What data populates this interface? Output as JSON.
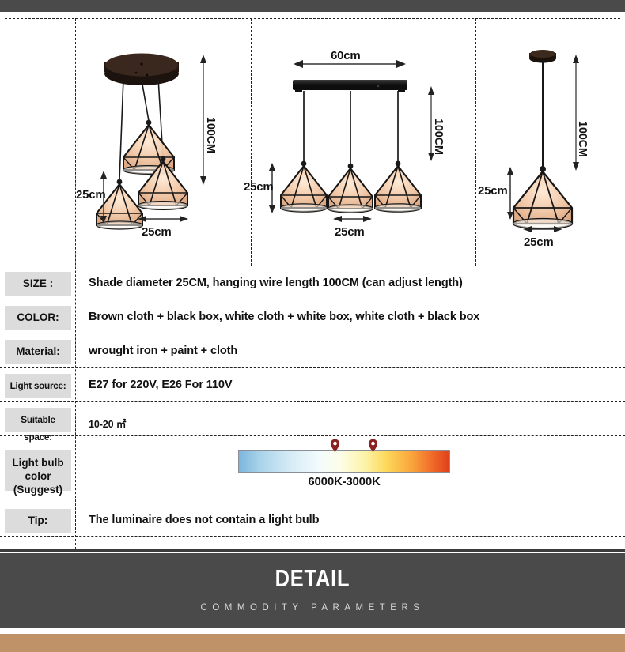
{
  "diagrams": {
    "panel_1": {
      "name": "three-light-round-canopy",
      "dim_height": "100CM",
      "dim_shade_height": "25cm",
      "dim_shade_width": "25cm"
    },
    "panel_2": {
      "name": "three-light-linear-bar",
      "dim_bar_width": "60cm",
      "dim_height": "100CM",
      "dim_shade_height": "25cm",
      "dim_shade_width": "25cm"
    },
    "panel_3": {
      "name": "single-light-pendant",
      "dim_height": "100CM",
      "dim_shade_height": "25cm",
      "dim_shade_width": "25cm"
    }
  },
  "spec_table": {
    "rows": [
      {
        "key": "SIZE :",
        "value": "Shade diameter 25CM, hanging wire length 100CM (can adjust length)"
      },
      {
        "key": "COLOR:",
        "value": "Brown cloth + black box,   white cloth + white box,  white cloth + black box"
      },
      {
        "key": "Material:",
        "value": "wrought iron + paint + cloth"
      },
      {
        "key": "Light source:",
        "value": "E27 for 220V, E26 For 110V"
      },
      {
        "key": "Suitable space:",
        "value": "10-20 ㎡"
      },
      {
        "key": "Light bulb color (Suggest)",
        "value": ""
      },
      {
        "key": "Tip:",
        "value": "The luminaire does not contain a light bulb"
      }
    ],
    "color_temperature": {
      "caption": "6000K-3000K",
      "pin_color": "#8c2020",
      "gradient_start": "#7cb6dd",
      "gradient_end": "#e0401c"
    }
  },
  "footer": {
    "title": "DETAIL",
    "subtitle": "COMMODITY PARAMETERS",
    "band_color": "#4a4a4a",
    "strip_color": "#bf9268"
  }
}
